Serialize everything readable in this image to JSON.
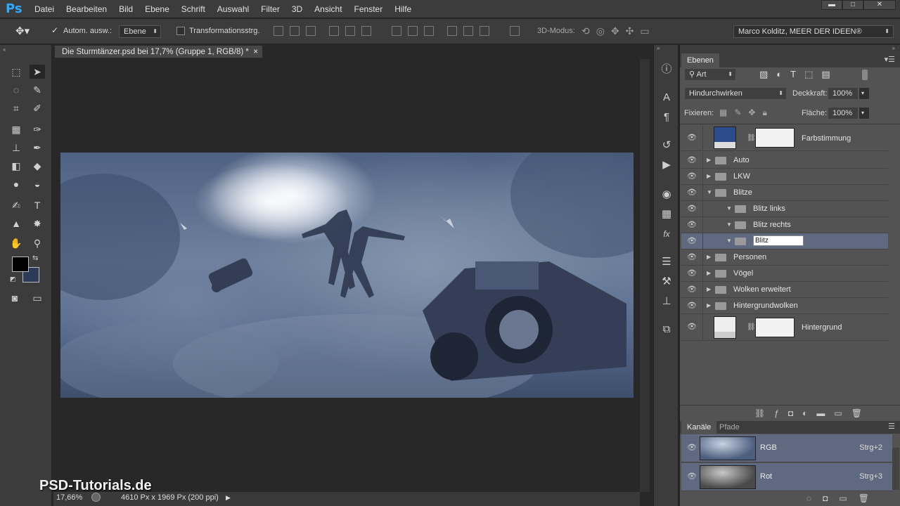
{
  "app": {
    "logo": "Ps"
  },
  "menu": [
    "Datei",
    "Bearbeiten",
    "Bild",
    "Ebene",
    "Schrift",
    "Auswahl",
    "Filter",
    "3D",
    "Ansicht",
    "Fenster",
    "Hilfe"
  ],
  "window_controls": {
    "minimize": "▬",
    "maximize": "□",
    "close": "✕"
  },
  "options": {
    "auto_select_label": "Autom. ausw.:",
    "auto_select_target": "Ebene",
    "transform_label": "Transformationsstrg.",
    "mode_3d_label": "3D-Modus:",
    "workspace": "Marco Kolditz, MEER DER IDEEN®"
  },
  "document": {
    "tab_title": "Die Sturmtänzer.psd bei 17,7% (Gruppe 1, RGB/8) *",
    "close": "×",
    "zoom": "17,66%",
    "info": "4610 Px x 1969 Px (200 ppi)"
  },
  "layers_panel": {
    "tab": "Ebenen",
    "filter_kind": "Art",
    "blend_mode": "Hindurchwirken",
    "opacity_label": "Deckkraft:",
    "opacity_value": "100%",
    "lock_label": "Fixieren:",
    "fill_label": "Fläche:",
    "fill_value": "100%",
    "layers": [
      {
        "name": "Farbstimmung",
        "type": "adjustment"
      },
      {
        "name": "Auto",
        "type": "group"
      },
      {
        "name": "LKW",
        "type": "group"
      },
      {
        "name": "Blitze",
        "type": "group",
        "expanded": true
      },
      {
        "name": "Blitz links",
        "type": "group",
        "expanded": true
      },
      {
        "name": "Blitz rechts",
        "type": "group",
        "expanded": true
      },
      {
        "name": "Blitz",
        "type": "group",
        "expanded": true,
        "selected": true,
        "editing": true
      },
      {
        "name": "Personen",
        "type": "group"
      },
      {
        "name": "Vögel",
        "type": "group"
      },
      {
        "name": "Wolken erweitert",
        "type": "group"
      },
      {
        "name": "Hintergrundwolken",
        "type": "group"
      },
      {
        "name": "Hintergrund",
        "type": "background"
      }
    ]
  },
  "channels_panel": {
    "tabs": [
      "Kanäle",
      "Pfade"
    ],
    "channels": [
      {
        "name": "RGB",
        "shortcut": "Strg+2"
      },
      {
        "name": "Rot",
        "shortcut": "Strg+3"
      }
    ]
  },
  "watermark": "PSD-Tutorials.de",
  "colors": {
    "accent": "#31a8ff",
    "selection": "#5f6a80",
    "foreground": "#000000",
    "background": "#2b3a56"
  }
}
